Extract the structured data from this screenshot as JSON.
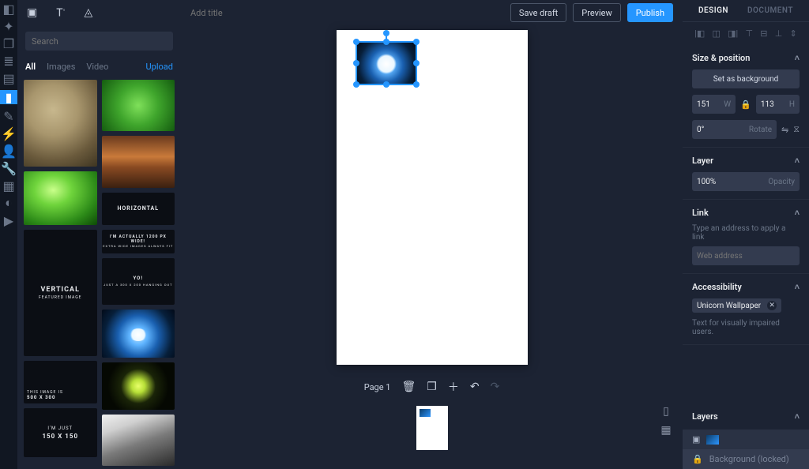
{
  "top": {
    "title_placeholder": "Add title",
    "save_draft": "Save draft",
    "preview": "Preview",
    "publish": "Publish"
  },
  "search": {
    "placeholder": "Search"
  },
  "media_tabs": {
    "all": "All",
    "images": "Images",
    "video": "Video",
    "upload": "Upload"
  },
  "thumbs": {
    "horizontal": "HORIZONTAL",
    "vertical_title": "VERTICAL",
    "vertical_sub": "FEATURED IMAGE",
    "wide_t": "I'M ACTUALLY 1200 PX WIDE!",
    "wide_s": "EXTRA WIDE IMAGES ALWAYS FIT",
    "yo_t": "YO!",
    "yo_s": "JUST A 300 X 200 HANGING OUT",
    "small_t": "THIS IMAGE IS",
    "small_s": "500 X 300",
    "sq_t": "I'M JUST",
    "sq_s": "150 X 150"
  },
  "page_controls": {
    "label": "Page 1"
  },
  "right_tabs": {
    "design": "DESIGN",
    "document": "DOCUMENT"
  },
  "size_pos": {
    "title": "Size & position",
    "set_bg": "Set as background",
    "w": "151",
    "wl": "W",
    "h": "113",
    "hl": "H",
    "rot": "0°",
    "rot_lbl": "Rotate"
  },
  "layer": {
    "title": "Layer",
    "opacity_val": "100%",
    "opacity_lbl": "Opacity"
  },
  "link": {
    "title": "Link",
    "hint": "Type an address to apply a link",
    "placeholder": "Web address"
  },
  "a11y": {
    "title": "Accessibility",
    "tag": "Unicorn Wallpaper",
    "hint": "Text for visually impaired users."
  },
  "layers": {
    "title": "Layers",
    "bg": "Background (locked)"
  }
}
